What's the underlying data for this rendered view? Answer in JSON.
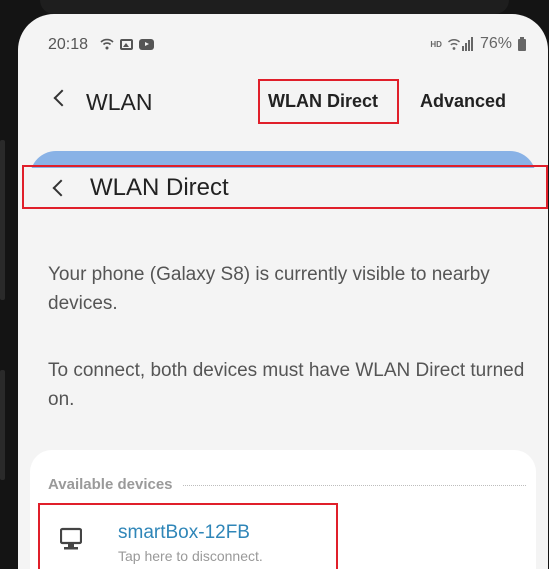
{
  "status_bar": {
    "time": "20:18",
    "hd_badge": "HD",
    "battery_percent": "76%"
  },
  "app_bar": {
    "title": "WLAN",
    "tabs": [
      {
        "label": "WLAN Direct",
        "highlighted": true
      },
      {
        "label": "Advanced",
        "highlighted": false
      }
    ]
  },
  "subpage": {
    "title": "WLAN Direct",
    "info": [
      "Your phone (Galaxy S8) is currently visible to nearby devices.",
      "To connect, both devices must have WLAN Direct turned on."
    ],
    "available_devices_label": "Available devices",
    "devices": [
      {
        "name": "smartBox-12FB",
        "status": "Tap here to disconnect.",
        "icon": "monitor-icon"
      }
    ]
  },
  "colors": {
    "highlight": "#e01f2a",
    "accent_blue": "#89b2e6",
    "device_link": "#2f86b8"
  }
}
